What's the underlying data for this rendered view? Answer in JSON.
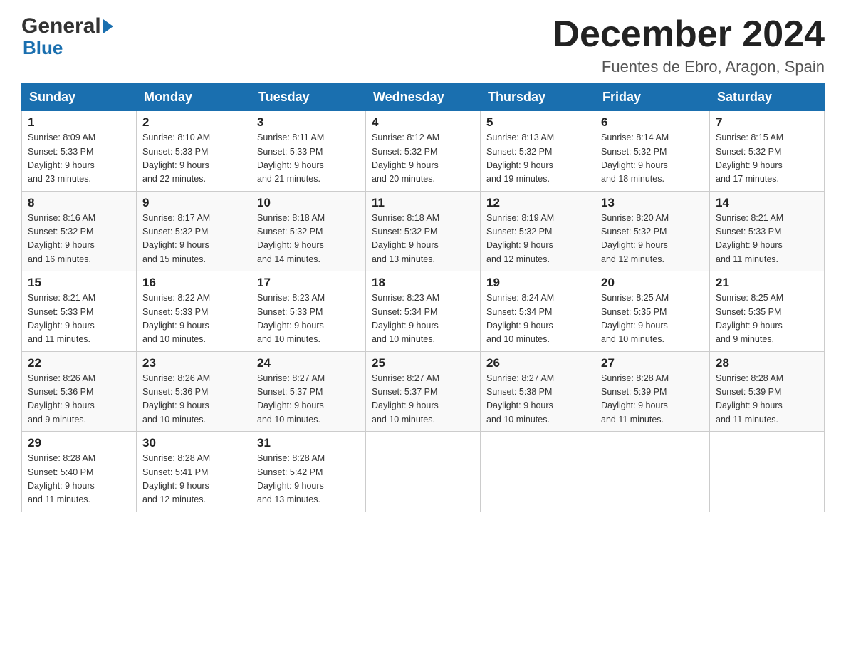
{
  "logo": {
    "general": "General",
    "blue": "Blue"
  },
  "title": "December 2024",
  "location": "Fuentes de Ebro, Aragon, Spain",
  "days_of_week": [
    "Sunday",
    "Monday",
    "Tuesday",
    "Wednesday",
    "Thursday",
    "Friday",
    "Saturday"
  ],
  "weeks": [
    [
      {
        "day": "1",
        "sunrise": "8:09 AM",
        "sunset": "5:33 PM",
        "daylight": "9 hours and 23 minutes."
      },
      {
        "day": "2",
        "sunrise": "8:10 AM",
        "sunset": "5:33 PM",
        "daylight": "9 hours and 22 minutes."
      },
      {
        "day": "3",
        "sunrise": "8:11 AM",
        "sunset": "5:33 PM",
        "daylight": "9 hours and 21 minutes."
      },
      {
        "day": "4",
        "sunrise": "8:12 AM",
        "sunset": "5:32 PM",
        "daylight": "9 hours and 20 minutes."
      },
      {
        "day": "5",
        "sunrise": "8:13 AM",
        "sunset": "5:32 PM",
        "daylight": "9 hours and 19 minutes."
      },
      {
        "day": "6",
        "sunrise": "8:14 AM",
        "sunset": "5:32 PM",
        "daylight": "9 hours and 18 minutes."
      },
      {
        "day": "7",
        "sunrise": "8:15 AM",
        "sunset": "5:32 PM",
        "daylight": "9 hours and 17 minutes."
      }
    ],
    [
      {
        "day": "8",
        "sunrise": "8:16 AM",
        "sunset": "5:32 PM",
        "daylight": "9 hours and 16 minutes."
      },
      {
        "day": "9",
        "sunrise": "8:17 AM",
        "sunset": "5:32 PM",
        "daylight": "9 hours and 15 minutes."
      },
      {
        "day": "10",
        "sunrise": "8:18 AM",
        "sunset": "5:32 PM",
        "daylight": "9 hours and 14 minutes."
      },
      {
        "day": "11",
        "sunrise": "8:18 AM",
        "sunset": "5:32 PM",
        "daylight": "9 hours and 13 minutes."
      },
      {
        "day": "12",
        "sunrise": "8:19 AM",
        "sunset": "5:32 PM",
        "daylight": "9 hours and 12 minutes."
      },
      {
        "day": "13",
        "sunrise": "8:20 AM",
        "sunset": "5:32 PM",
        "daylight": "9 hours and 12 minutes."
      },
      {
        "day": "14",
        "sunrise": "8:21 AM",
        "sunset": "5:33 PM",
        "daylight": "9 hours and 11 minutes."
      }
    ],
    [
      {
        "day": "15",
        "sunrise": "8:21 AM",
        "sunset": "5:33 PM",
        "daylight": "9 hours and 11 minutes."
      },
      {
        "day": "16",
        "sunrise": "8:22 AM",
        "sunset": "5:33 PM",
        "daylight": "9 hours and 10 minutes."
      },
      {
        "day": "17",
        "sunrise": "8:23 AM",
        "sunset": "5:33 PM",
        "daylight": "9 hours and 10 minutes."
      },
      {
        "day": "18",
        "sunrise": "8:23 AM",
        "sunset": "5:34 PM",
        "daylight": "9 hours and 10 minutes."
      },
      {
        "day": "19",
        "sunrise": "8:24 AM",
        "sunset": "5:34 PM",
        "daylight": "9 hours and 10 minutes."
      },
      {
        "day": "20",
        "sunrise": "8:25 AM",
        "sunset": "5:35 PM",
        "daylight": "9 hours and 10 minutes."
      },
      {
        "day": "21",
        "sunrise": "8:25 AM",
        "sunset": "5:35 PM",
        "daylight": "9 hours and 9 minutes."
      }
    ],
    [
      {
        "day": "22",
        "sunrise": "8:26 AM",
        "sunset": "5:36 PM",
        "daylight": "9 hours and 9 minutes."
      },
      {
        "day": "23",
        "sunrise": "8:26 AM",
        "sunset": "5:36 PM",
        "daylight": "9 hours and 10 minutes."
      },
      {
        "day": "24",
        "sunrise": "8:27 AM",
        "sunset": "5:37 PM",
        "daylight": "9 hours and 10 minutes."
      },
      {
        "day": "25",
        "sunrise": "8:27 AM",
        "sunset": "5:37 PM",
        "daylight": "9 hours and 10 minutes."
      },
      {
        "day": "26",
        "sunrise": "8:27 AM",
        "sunset": "5:38 PM",
        "daylight": "9 hours and 10 minutes."
      },
      {
        "day": "27",
        "sunrise": "8:28 AM",
        "sunset": "5:39 PM",
        "daylight": "9 hours and 11 minutes."
      },
      {
        "day": "28",
        "sunrise": "8:28 AM",
        "sunset": "5:39 PM",
        "daylight": "9 hours and 11 minutes."
      }
    ],
    [
      {
        "day": "29",
        "sunrise": "8:28 AM",
        "sunset": "5:40 PM",
        "daylight": "9 hours and 11 minutes."
      },
      {
        "day": "30",
        "sunrise": "8:28 AM",
        "sunset": "5:41 PM",
        "daylight": "9 hours and 12 minutes."
      },
      {
        "day": "31",
        "sunrise": "8:28 AM",
        "sunset": "5:42 PM",
        "daylight": "9 hours and 13 minutes."
      },
      null,
      null,
      null,
      null
    ]
  ],
  "labels": {
    "sunrise": "Sunrise:",
    "sunset": "Sunset:",
    "daylight": "Daylight:"
  },
  "accent_color": "#1a6faf"
}
